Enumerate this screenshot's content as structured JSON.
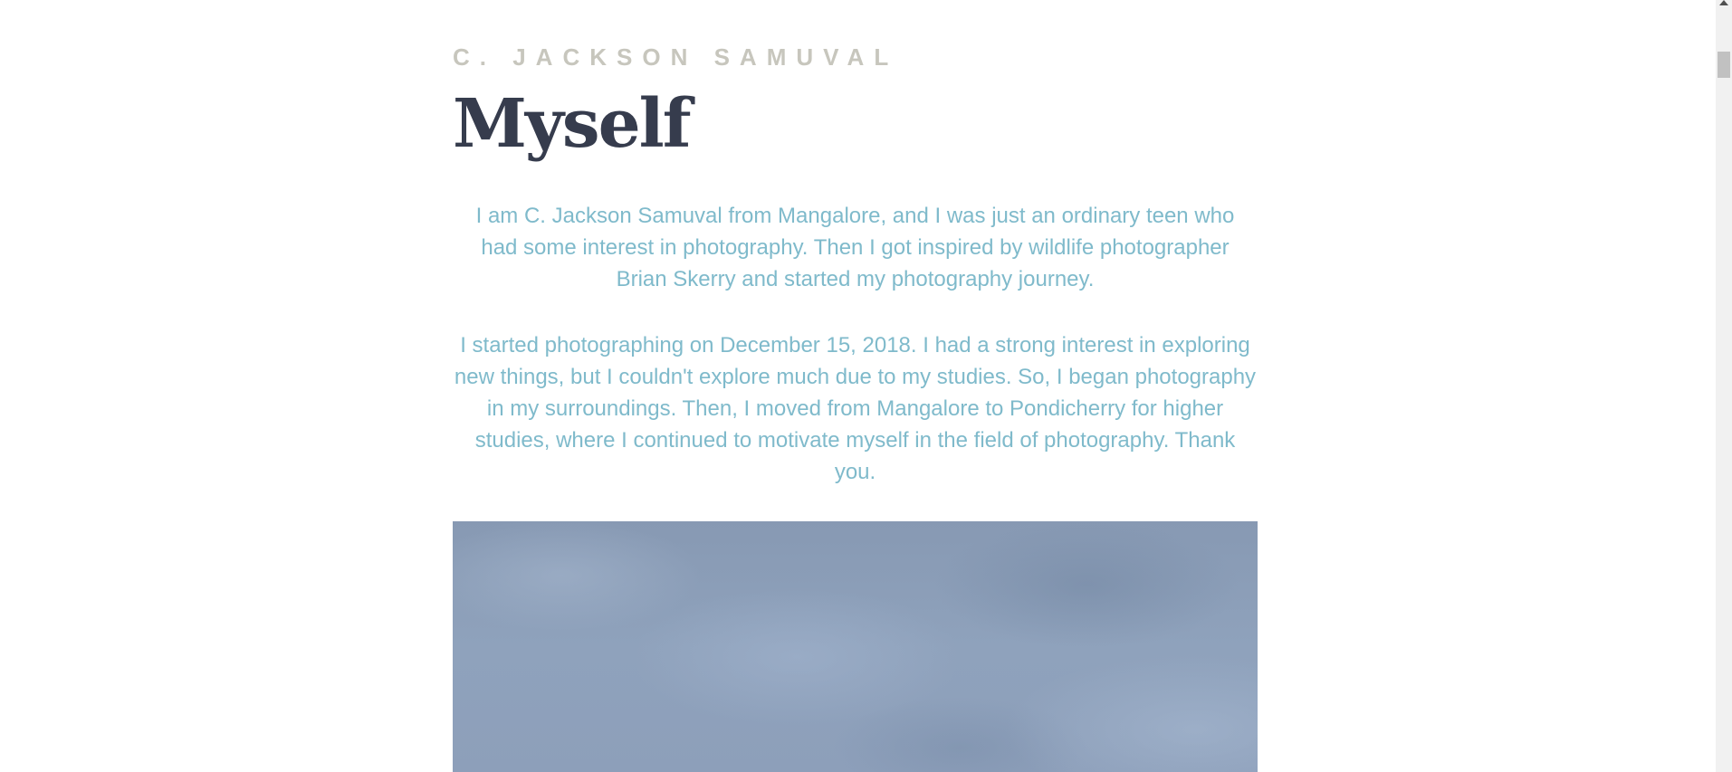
{
  "site": {
    "name": "C. JACKSON SAMUVAL"
  },
  "page": {
    "title": "Myself",
    "paragraphs": [
      "I am C. Jackson Samuval from Mangalore, and I was just an ordinary teen who had some interest in photography. Then I got inspired by wildlife photographer Brian Skerry and started my photography journey.",
      "I started photographing on December 15, 2018. I had a strong interest in exploring new things, but I couldn't explore much due to my studies. So, I began photography in my surroundings. Then, I moved from Mangalore to Pondicherry for higher studies, where I continued to motivate myself in the field of photography. Thank you."
    ]
  },
  "colors": {
    "site_name": "#c7c6bd",
    "title": "#363c4d",
    "body_text": "#7fbacb",
    "hero_sky": "#8d9fba"
  },
  "icons": {
    "scroll_up": "chevron-up-icon"
  }
}
